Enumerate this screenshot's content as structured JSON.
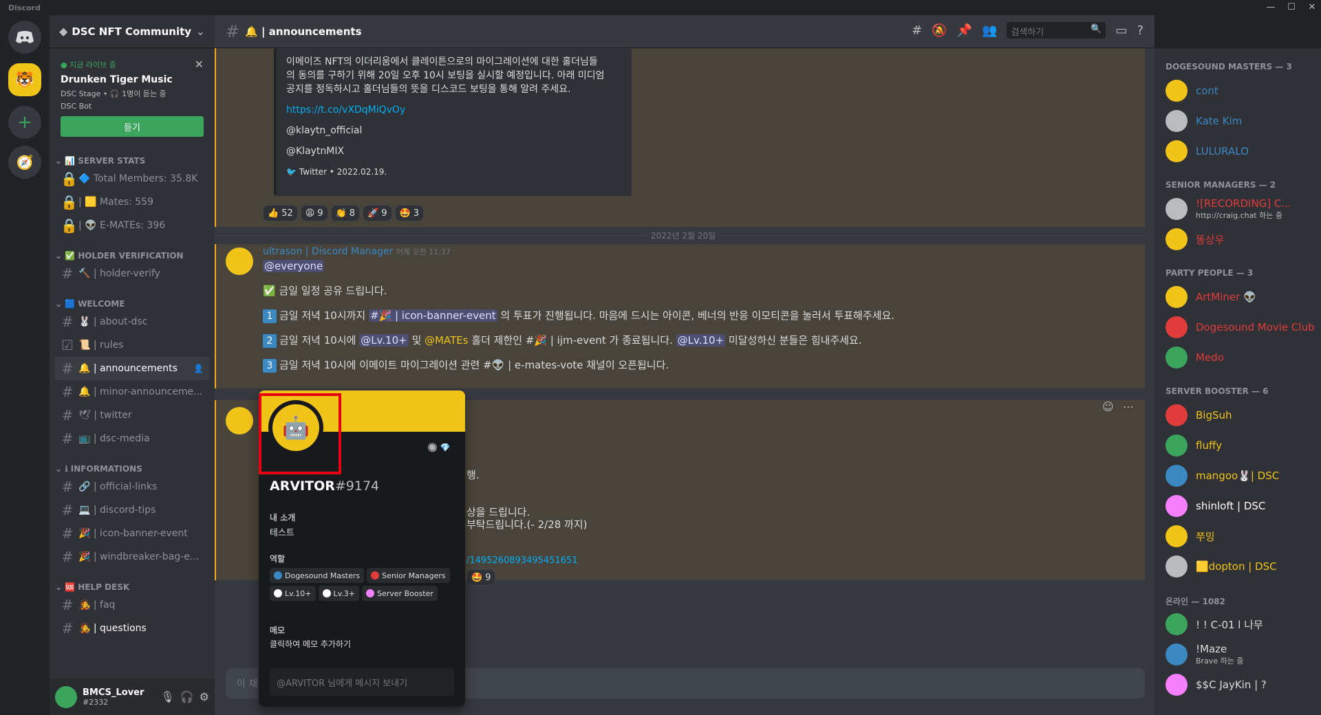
{
  "titlebar": {
    "app": "Discord"
  },
  "server": {
    "name": "DSC NFT Community"
  },
  "live": {
    "label": "● 지금 라이브 중",
    "title": "Drunken Tiger Music",
    "meta": "DSC Stage • 🎧 1명이 듣는 중",
    "bot": "DSC Bot",
    "button": "듣기"
  },
  "categories": {
    "stats": "SERVER STATS",
    "holder": "HOLDER VERIFICATION",
    "welcome": "WELCOME",
    "info": "INFORMATIONS",
    "help": "HELP DESK"
  },
  "channels": {
    "total": "🔷 Total Members: 35.8K",
    "mates": "| 🟨 Mates: 559",
    "emates": "| 👽 E-MATEs: 396",
    "verify": "🔨 | holder-verify",
    "about": "🐰 | about-dsc",
    "rules": "📜 | rules",
    "announcements": "🔔 | announcements",
    "minor": "🔔 | minor-announceme...",
    "twitter": "🕊 | twitter",
    "media": "📺 | dsc-media",
    "links": "🔗 | official-links",
    "tips": "💻 | discord-tips",
    "icon": "🎉 | icon-banner-event",
    "wind": "🎉 | windbreaker-bag-e...",
    "faq": "🧑‍🎤 | faq",
    "questions": "🧑‍🎤 | questions"
  },
  "user": {
    "name": "BMCS_Lover",
    "tag": "#2332"
  },
  "header": {
    "channel": "🔔 | announcements",
    "search": "검색하기"
  },
  "embed": {
    "line1": "이메이즈 NFT의 이더리움에서 클레이튼으로의 마이그레이션에 대한 홀더님들",
    "line2": "의 동의를 구하기 위해 20일 오후 10시 보팅을 실시할 예정입니다. 아래 미디엄",
    "line3": "공지를 정독하시고 홀더님들의 뜻을 디스코드 보팅을 통해 알려 주세요.",
    "link": "https://t.co/vXDqMiQvOy",
    "h1": "@klaytn_official",
    "h2": "@KlaytnMIX",
    "footer": "Twitter • 2022.02.19."
  },
  "reactions": [
    {
      "e": "👍",
      "n": "52"
    },
    {
      "e": "😩",
      "n": "9"
    },
    {
      "e": "👏",
      "n": "8"
    },
    {
      "e": "🚀",
      "n": "9"
    },
    {
      "e": "🤩",
      "n": "3"
    }
  ],
  "date": "2022년 2월 20일",
  "msg": {
    "author": "ultrason | Discord Manager",
    "time": "어제 오전 11:37",
    "everyone": "@everyone",
    "l1": "✅ 금일 일정 공유 드립니다.",
    "l2a": "금일 저녁 10시까지 ",
    "l2m": "#🎉 | icon-banner-event",
    "l2b": " 의 투표가 진행됩니다. 마음에 드시는 아이콘, 베너의 반응 이모티콘을 눌러서 투표해주세요.",
    "l3a": "금일 저녁 10시에 ",
    "l3m1": "@Lv.10+",
    "l3b": " 및 ",
    "l3m2": "@MATEs",
    "l3c": " 홀더 제한인 #🎉 | ijm-event 가 종료됩니다. ",
    "l3m3": "@Lv.10+",
    "l3d": " 미달성하신 분들은 힘내주세요.",
    "l4": "금일 저녁 10시에 이메이트 마이그레이션 관련 #👽 | e-mates-vote 채널이 오픈됩니다.",
    "n1": "1",
    "n2": "2",
    "n3": "3"
  },
  "msg2": {
    "t1": "행.",
    "t2": "상을 드립니다.",
    "t3": "부탁드립니다.(- 2/28 까지)",
    "link": "/1495260893495451651",
    "react": "9"
  },
  "input": {
    "placeholder": "이 채"
  },
  "popout": {
    "name": "ARVITOR",
    "tag": "#9174",
    "about_label": "내 소개",
    "about": "테스트",
    "roles_label": "역할",
    "note_label": "메모",
    "note": "클릭하여 메모 추가하기",
    "msg": "@ARVITOR 님에게 메시지 보내기",
    "roles": [
      {
        "name": "Dogesound Masters",
        "color": "#3b88c3"
      },
      {
        "name": "Senior Managers",
        "color": "#e03c3c"
      },
      {
        "name": "Lv.10+",
        "color": "#ffffff"
      },
      {
        "name": "Lv.3+",
        "color": "#ffffff"
      },
      {
        "name": "Server Booster",
        "color": "#f47fff"
      }
    ]
  },
  "members": {
    "cats": [
      "DOGESOUND MASTERS — 3",
      "SENIOR MANAGERS — 2",
      "PARTY PEOPLE — 3",
      "SERVER BOOSTER — 6",
      "온라인 — 1082"
    ],
    "list1": [
      {
        "n": "cont",
        "c": "#3b88c3"
      },
      {
        "n": "Kate Kim",
        "c": "#3b88c3"
      },
      {
        "n": "LULURALO",
        "c": "#3b88c3"
      }
    ],
    "list2": [
      {
        "n": "![RECORDING] C...",
        "c": "#e03c3c",
        "s": "http://craig.chat 하는 중"
      },
      {
        "n": "똥상우",
        "c": "#e03c3c"
      }
    ],
    "list3": [
      {
        "n": "ArtMiner 👽",
        "c": "#e03c3c"
      },
      {
        "n": "Dogesound Movie Club",
        "c": "#e03c3c"
      },
      {
        "n": "Medo",
        "c": "#e03c3c"
      }
    ],
    "list4": [
      {
        "n": "BigSuh",
        "c": "#f0c419"
      },
      {
        "n": "fluffy",
        "c": "#f0c419"
      },
      {
        "n": "mangoo🐰| DSC",
        "c": "#f0c419"
      },
      {
        "n": "shinloft | DSC",
        "c": "#ffffff"
      },
      {
        "n": "쭈밍",
        "c": "#f0c419"
      },
      {
        "n": "🟨dopton | DSC",
        "c": "#f0c419"
      }
    ],
    "list5": [
      {
        "n": "! ! C-01 l 나무",
        "c": "#dcddde"
      },
      {
        "n": "!Maze",
        "c": "#dcddde",
        "s": "Brave 하는 중"
      },
      {
        "n": "$$C JayKin | ?",
        "c": "#dcddde"
      }
    ]
  }
}
